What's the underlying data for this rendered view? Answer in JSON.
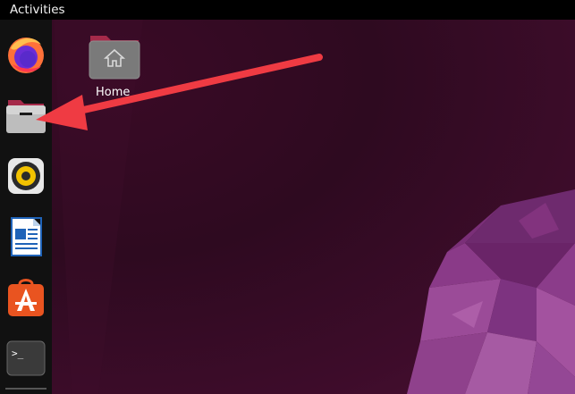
{
  "topbar": {
    "activities_label": "Activities"
  },
  "desktop": {
    "home_label": "Home"
  },
  "dock": {
    "items": [
      {
        "name": "firefox",
        "icon": "firefox-icon"
      },
      {
        "name": "files",
        "icon": "files-icon"
      },
      {
        "name": "rhythmbox",
        "icon": "rhythmbox-icon"
      },
      {
        "name": "libreoffice-writer",
        "icon": "writer-icon"
      },
      {
        "name": "ubuntu-software",
        "icon": "software-icon"
      },
      {
        "name": "terminal",
        "icon": "terminal-icon"
      }
    ],
    "terminal_prompt": ">_"
  },
  "colors": {
    "accent_arrow": "#ef3b43",
    "wallpaper_dark": "#2e0a20",
    "wallpaper_purple": "#7c2a7a",
    "dock_bg": "#111111"
  }
}
